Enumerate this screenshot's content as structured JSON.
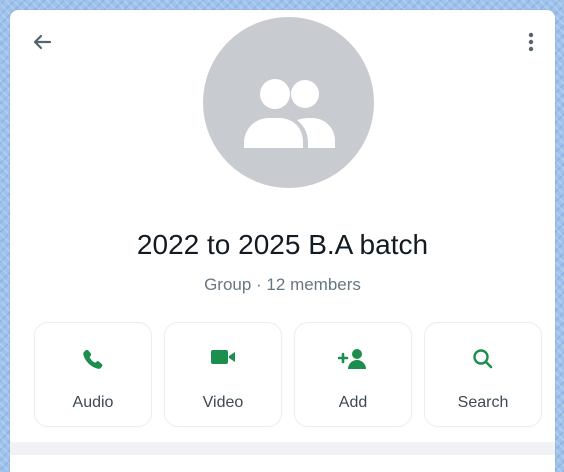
{
  "header": {
    "back_icon": "arrow-left-icon",
    "menu_icon": "more-vertical-icon"
  },
  "group": {
    "avatar_icon": "group-icon",
    "name": "2022 to 2025 B.A batch",
    "subtitle": "Group · 12 members"
  },
  "actions": [
    {
      "label": "Audio",
      "icon": "phone-icon"
    },
    {
      "label": "Video",
      "icon": "video-camera-icon"
    },
    {
      "label": "Add",
      "icon": "add-person-icon"
    },
    {
      "label": "Search",
      "icon": "search-icon"
    }
  ],
  "colors": {
    "accent": "#1c8f4f",
    "avatar_bg": "#c8ccd1",
    "title": "#111b21",
    "subtitle": "#667781",
    "action_label": "#3b4a54"
  }
}
